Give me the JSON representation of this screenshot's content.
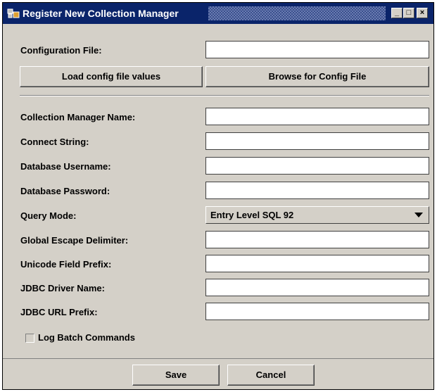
{
  "window": {
    "title": "Register New Collection Manager",
    "controls": {
      "minimize": "_",
      "maximize": "□",
      "close": "×"
    }
  },
  "config": {
    "label": "Configuration File:",
    "value": "",
    "load_button": "Load config file values",
    "browse_button": "Browse for Config File"
  },
  "fields": {
    "name": {
      "label": "Collection Manager Name:",
      "value": ""
    },
    "connect": {
      "label": "Connect String:",
      "value": ""
    },
    "username": {
      "label": "Database Username:",
      "value": ""
    },
    "password": {
      "label": "Database Password:",
      "value": ""
    },
    "query_mode": {
      "label": "Query Mode:",
      "value": "Entry Level SQL 92"
    },
    "escape": {
      "label": "Global Escape Delimiter:",
      "value": ""
    },
    "unicode": {
      "label": "Unicode Field Prefix:",
      "value": ""
    },
    "driver": {
      "label": "JDBC Driver Name:",
      "value": ""
    },
    "url_prefix": {
      "label": "JDBC URL Prefix:",
      "value": ""
    }
  },
  "log_batch": {
    "label": "Log Batch Commands",
    "checked": false
  },
  "actions": {
    "save": "Save",
    "cancel": "Cancel"
  }
}
